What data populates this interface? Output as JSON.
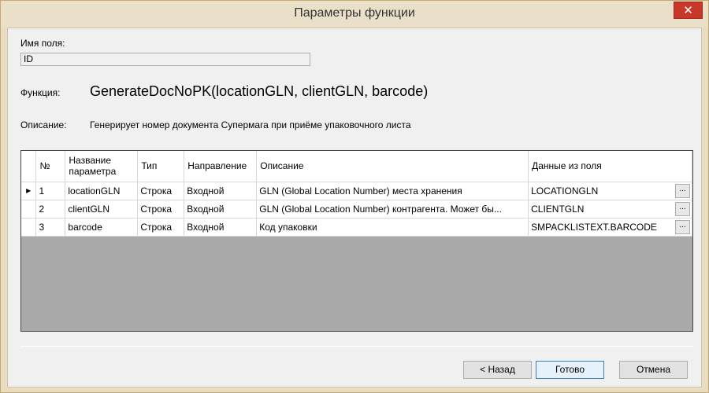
{
  "window": {
    "title": "Параметры функции",
    "close_glyph": "✕"
  },
  "form": {
    "field_label": "Имя поля:",
    "field_value": "ID",
    "function_label": "Функция:",
    "function_value": "GenerateDocNoPK(locationGLN, clientGLN, barcode)",
    "description_label": "Описание:",
    "description_value": "Генерирует номер документа Супермага при приёме упаковочного листа"
  },
  "grid": {
    "columns": [
      "№",
      "Название параметра",
      "Тип",
      "Направление",
      "Описание",
      "Данные из поля"
    ],
    "rows": [
      {
        "num": "1",
        "name": "locationGLN",
        "type": "Строка",
        "direction": "Входной",
        "description": "GLN (Global Location Number) места хранения",
        "data": "LOCATIONGLN",
        "current": true
      },
      {
        "num": "2",
        "name": "clientGLN",
        "type": "Строка",
        "direction": "Входной",
        "description": "GLN (Global Location Number) контрагента. Может бы...",
        "data": "CLIENTGLN",
        "current": false
      },
      {
        "num": "3",
        "name": "barcode",
        "type": "Строка",
        "direction": "Входной",
        "description": "Код упаковки",
        "data": "SMPACKLISTEXT.BARCODE",
        "current": false
      }
    ],
    "current_row_glyph": "▶",
    "ellipsis_label": "..."
  },
  "buttons": {
    "back": "< Назад",
    "done": "Готово",
    "cancel": "Отмена"
  }
}
